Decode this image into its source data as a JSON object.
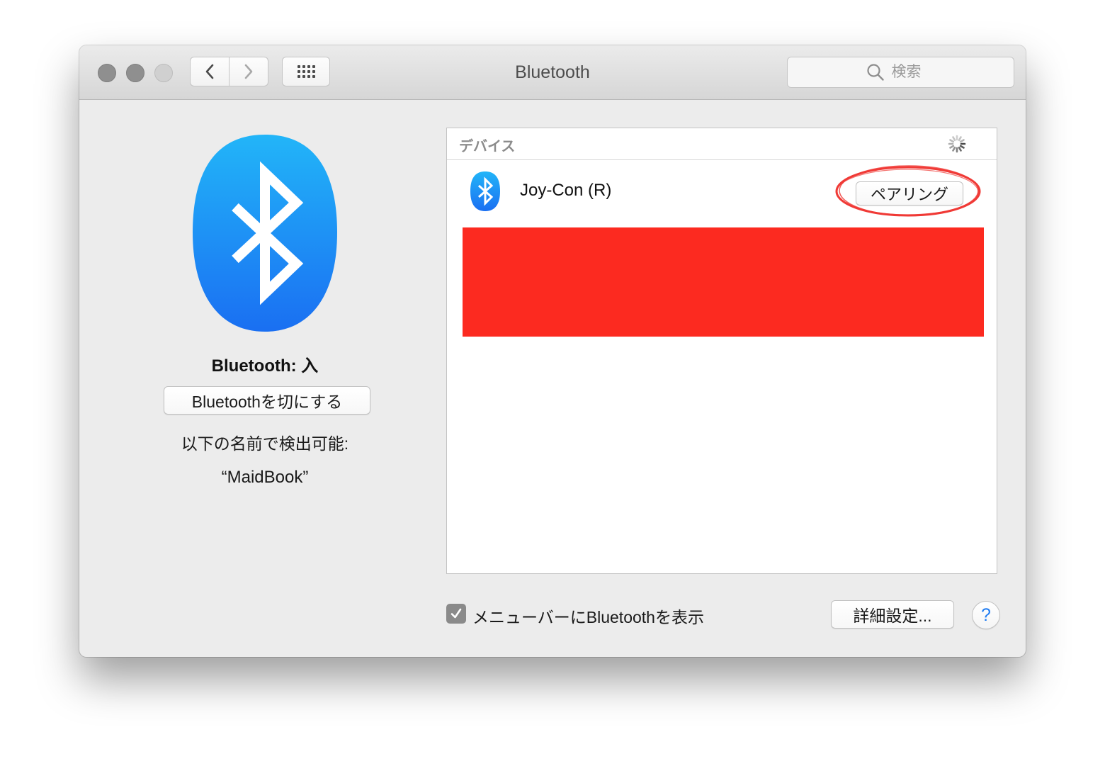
{
  "window": {
    "title": "Bluetooth"
  },
  "toolbar": {
    "back_icon": "chevron-left-icon",
    "forward_icon": "chevron-right-icon",
    "grid_icon": "show-all-grid-icon",
    "search_placeholder": "検索"
  },
  "left_panel": {
    "status": "Bluetooth: 入",
    "toggle_button_label": "Bluetoothを切にする",
    "discoverable_label": "以下の名前で検出可能:",
    "device_name": "“MaidBook”"
  },
  "devices": {
    "header": "デバイス",
    "items": [
      {
        "name": "Joy-Con (R)",
        "icon": "bluetooth-device-icon",
        "action_label": "ペアリング"
      }
    ]
  },
  "bottom": {
    "show_in_menubar_label": "メニューバーにBluetoothを表示",
    "show_in_menubar_checked": true,
    "advanced_button_label": "詳細設定...",
    "help_label": "?"
  },
  "colors": {
    "accent": "#1f7cf2",
    "bluetooth_top": "#22b5f8",
    "bluetooth_bottom": "#1a6ff2",
    "annotation_red": "#fc2a20"
  }
}
